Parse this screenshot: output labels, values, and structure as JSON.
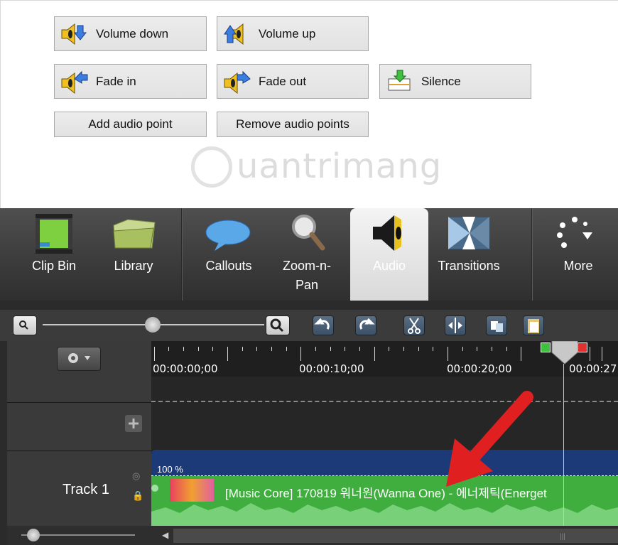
{
  "audio_buttons": {
    "volume_down": "Volume down",
    "volume_up": "Volume up",
    "fade_in": "Fade in",
    "fade_out": "Fade out",
    "silence": "Silence",
    "add_audio_point": "Add audio point",
    "remove_audio_points": "Remove audio points"
  },
  "watermark": "uantrimang",
  "tools": [
    {
      "label": "Clip Bin",
      "icon": "film-icon"
    },
    {
      "label": "Library",
      "icon": "folder-icon"
    },
    {
      "label": "Callouts",
      "icon": "speech-bubble-icon"
    },
    {
      "label": "Zoom-n-\nPan",
      "icon": "magnifier-icon"
    },
    {
      "label": "Audio",
      "icon": "speaker-icon"
    },
    {
      "label": "Transitions",
      "icon": "transition-icon"
    },
    {
      "label": "More",
      "icon": "more-dots-icon"
    }
  ],
  "timeline": {
    "ticks": [
      "00:00:00;00",
      "00:00:10;00",
      "00:00:20;00",
      "00:00:27"
    ],
    "track_name": "Track 1",
    "clip_volume": "100 %",
    "clip_title": "[Music Core] 170819 워너원(Wanna One) - 에너제틱(Energet"
  },
  "colors": {
    "accent_blue": "#3c5066",
    "clip_blue": "#1c3a78",
    "audio_green": "#3fae3f",
    "arrow_red": "#e02020"
  }
}
